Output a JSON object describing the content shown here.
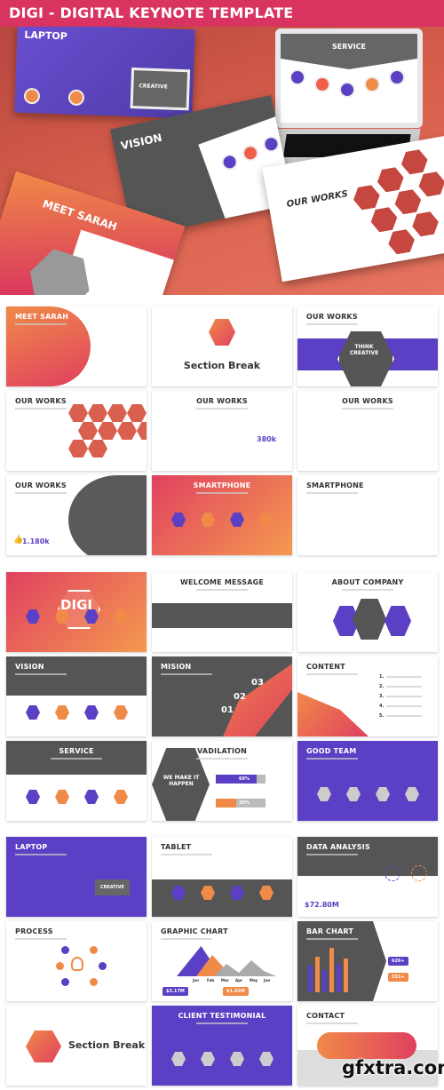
{
  "banner": {
    "title": "DIGI - DIGITAL KEYNOTE TEMPLATE",
    "color": "#d8345f"
  },
  "hero": {
    "mockups": [
      {
        "title": "LAPTOP",
        "subtitle": "CREATIVE"
      },
      {
        "title": "SERVICE"
      },
      {
        "title": "VISION"
      },
      {
        "title": "MEET SARAH"
      },
      {
        "title": "OUR WORKS"
      }
    ]
  },
  "colors": {
    "purple": "#5b3fc4",
    "orange": "#f08a48",
    "red": "#e0405f",
    "dark": "#555555"
  },
  "slides": [
    {
      "title": "MEET SARAH",
      "theme": "orange-left",
      "align": "left"
    },
    {
      "title": "",
      "theme": "white",
      "align": "center",
      "big": "Section Break",
      "icon": "clock-hexagon"
    },
    {
      "title": "OUR WORKS",
      "theme": "purple-band",
      "align": "left",
      "big": "THINK CREATIVE"
    },
    {
      "title": "OUR WORKS",
      "theme": "hexgrid",
      "align": "left"
    },
    {
      "title": "OUR WORKS",
      "theme": "white",
      "align": "center",
      "big": "380k"
    },
    {
      "title": "OUR WORKS",
      "theme": "white",
      "align": "center"
    },
    {
      "title": "OUR WORKS",
      "theme": "dark-circle",
      "align": "left",
      "big": "1.180k",
      "icon": "thumbs-up"
    },
    {
      "title": "SMARTPHONE",
      "theme": "orange",
      "align": "center"
    },
    {
      "title": "SMARTPHONE",
      "theme": "white",
      "align": "left"
    },
    {
      "title": "",
      "theme": "orange",
      "align": "center",
      "big": "DIGI"
    },
    {
      "title": "WELCOME MESSAGE",
      "theme": "white-dark-band",
      "align": "center"
    },
    {
      "title": "ABOUT COMPANY",
      "theme": "white-hex",
      "align": "center"
    },
    {
      "title": "VISION",
      "theme": "dark-top",
      "align": "left"
    },
    {
      "title": "MISION",
      "theme": "dark",
      "align": "left",
      "numbers": [
        "01",
        "02",
        "03"
      ]
    },
    {
      "title": "CONTENT",
      "theme": "white-orange",
      "align": "left",
      "list": [
        "1.",
        "2.",
        "3.",
        "4.",
        "5."
      ]
    },
    {
      "title": "SERVICE",
      "theme": "dark-top",
      "align": "center"
    },
    {
      "title": "VADILATION",
      "theme": "white-hexdark",
      "align": "center",
      "big": "WE MAKE IT HAPPEN",
      "bars": [
        {
          "label": "60%",
          "value": 60
        },
        {
          "label": "20%",
          "value": 20
        }
      ]
    },
    {
      "title": "GOOD TEAM",
      "theme": "purple",
      "align": "left"
    },
    {
      "title": "LAPTOP",
      "theme": "purple",
      "align": "left",
      "big": "CREATIVE"
    },
    {
      "title": "TABLET",
      "theme": "white-dark-bottom",
      "align": "left"
    },
    {
      "title": "DATA ANALYSIS",
      "theme": "dark-top",
      "align": "left",
      "big": "$72.80M",
      "gauges": [
        "50%",
        "20%"
      ]
    },
    {
      "title": "PROCESS",
      "theme": "white",
      "align": "left",
      "icon": "lightbulb"
    },
    {
      "title": "GRAPHIC CHART",
      "theme": "white-mountain",
      "align": "left",
      "months": [
        "Jan",
        "Feb",
        "Mar",
        "Apr",
        "May",
        "Jun"
      ],
      "badges": [
        "$3.17M",
        "$1.42M"
      ]
    },
    {
      "title": "BAR CHART",
      "theme": "dark-left",
      "align": "left",
      "badges": [
        "626+",
        "351+"
      ]
    },
    {
      "title": "",
      "theme": "white",
      "align": "center",
      "big": "Section Break",
      "icon": "clock-hexagon"
    },
    {
      "title": "CLIENT TESTIMONIAL",
      "theme": "purple",
      "align": "center"
    },
    {
      "title": "CONTACT",
      "theme": "white-contact",
      "align": "left"
    }
  ],
  "watermark": "gfxtra.com"
}
